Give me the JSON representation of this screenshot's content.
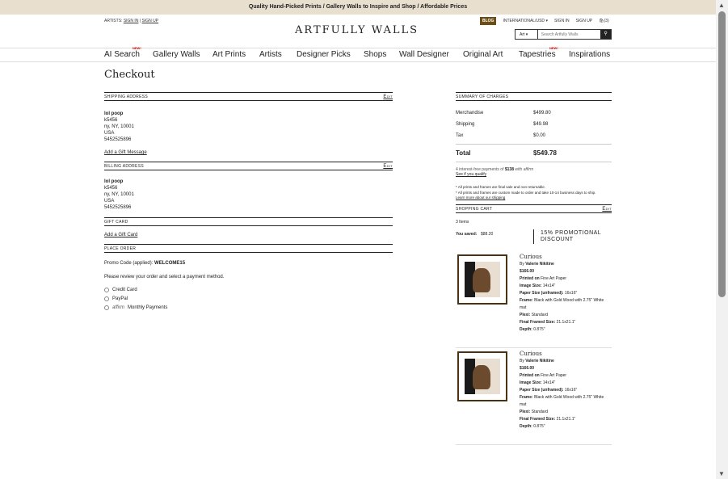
{
  "topbar": {
    "text": "Quality Hand-Picked Prints  /  Gallery Walls to Inspire and Shop  /  Affordable Prices"
  },
  "header": {
    "artists_label": "ARTISTS:",
    "artist_sign_in": "SIGN IN",
    "artist_sign_up": "SIGN UP",
    "logo": "ARTFULLY WALLS",
    "blog": "BLOG",
    "region": "INTERNATIONAL/USD",
    "sign_in": "SIGN IN",
    "sign_up": "SIGN UP",
    "cart": "(3)",
    "search_scope": "Art",
    "search_placeholder": "Search Artfully Walls"
  },
  "nav": {
    "items": [
      "AI Search",
      "Gallery Walls",
      "Art Prints",
      "Artists",
      "Designer Picks",
      "Shops",
      "Wall Designer",
      "Original Art",
      "Tapestries",
      "Inspirations"
    ],
    "new_badge": "NEW!"
  },
  "page_title": "Checkout",
  "shipping": {
    "heading": "Shipping Address",
    "edit": "Edit",
    "name": "lol poop",
    "line1": "k5456",
    "line2": "ny, NY, 10001",
    "country": "USA",
    "phone": "5452525896",
    "gift_msg": "Add a Gift Message"
  },
  "billing": {
    "heading": "Billing Address",
    "edit": "Edit",
    "name": "lol poop",
    "line1": "k5456",
    "line2": "ny, NY, 10001",
    "country": "USA",
    "phone": "5452525896"
  },
  "gift_card": {
    "heading": "Gift Card",
    "add": "Add a Gift Card"
  },
  "place_order": {
    "heading": "Place Order",
    "promo_label": "Promo Code (applied):",
    "promo_code": "WELCOME15",
    "instruction": "Please review your order and select a payment method.",
    "options": [
      "Credit Card",
      "PayPal",
      "Monthly Payments"
    ],
    "affirm": "affirm"
  },
  "summary": {
    "heading": "Summary of Charges",
    "merch_label": "Merchandise",
    "merch": "$499.80",
    "ship_label": "Shipping",
    "ship": "$49.98",
    "tax_label": "Tax",
    "tax": "$0.00",
    "total_label": "Total",
    "total": "$549.78",
    "affirm_text": "4 interest-free payments of",
    "affirm_amount": "$138",
    "affirm_with": "with",
    "affirm_brand": "affirm",
    "qualify": "See if you qualify",
    "note1": "* All prints and frames are final sale and non-returnable.",
    "note2": "* All prints and frames are custom made to order and take 10-14 business days to ship.",
    "shipping_link": "Learn more about our shipping"
  },
  "cart": {
    "heading": "Shopping Cart",
    "edit": "Edit",
    "count": "3 Items",
    "saved_label": "You saved:",
    "saved": "$88.20",
    "promo": "15% PROMOTIONAL DISCOUNT",
    "items": [
      {
        "title": "Curious",
        "by": "By",
        "artist": "Valerie Nikitine",
        "price": "$166.00",
        "printed_label": "Printed on",
        "printed": "Fine Art Paper",
        "size_label": "Image Size:",
        "size": "14x14\"",
        "paper_label": "Paper Size (unframed):",
        "paper": "16x16\"",
        "frame_label": "Frame:",
        "frame": "Black with Gold Wood with 2.75\" White mat",
        "plexi_label": "Plexi:",
        "plexi": "Standard",
        "final_label": "Final Framed Size:",
        "final": "21.1x21.1\"",
        "depth_label": "Depth:",
        "depth": "0.875\""
      },
      {
        "title": "Curious",
        "by": "By",
        "artist": "Valerie Nikitine",
        "price": "$166.00",
        "printed_label": "Printed on",
        "printed": "Fine Art Paper",
        "size_label": "Image Size:",
        "size": "14x14\"",
        "paper_label": "Paper Size (unframed):",
        "paper": "16x16\"",
        "frame_label": "Frame:",
        "frame": "Black with Gold Wood with 2.75\" White mat",
        "plexi_label": "Plexi:",
        "plexi": "Standard",
        "final_label": "Final Framed Size:",
        "final": "21.1x21.1\"",
        "depth_label": "Depth:",
        "depth": "0.875\""
      }
    ]
  }
}
